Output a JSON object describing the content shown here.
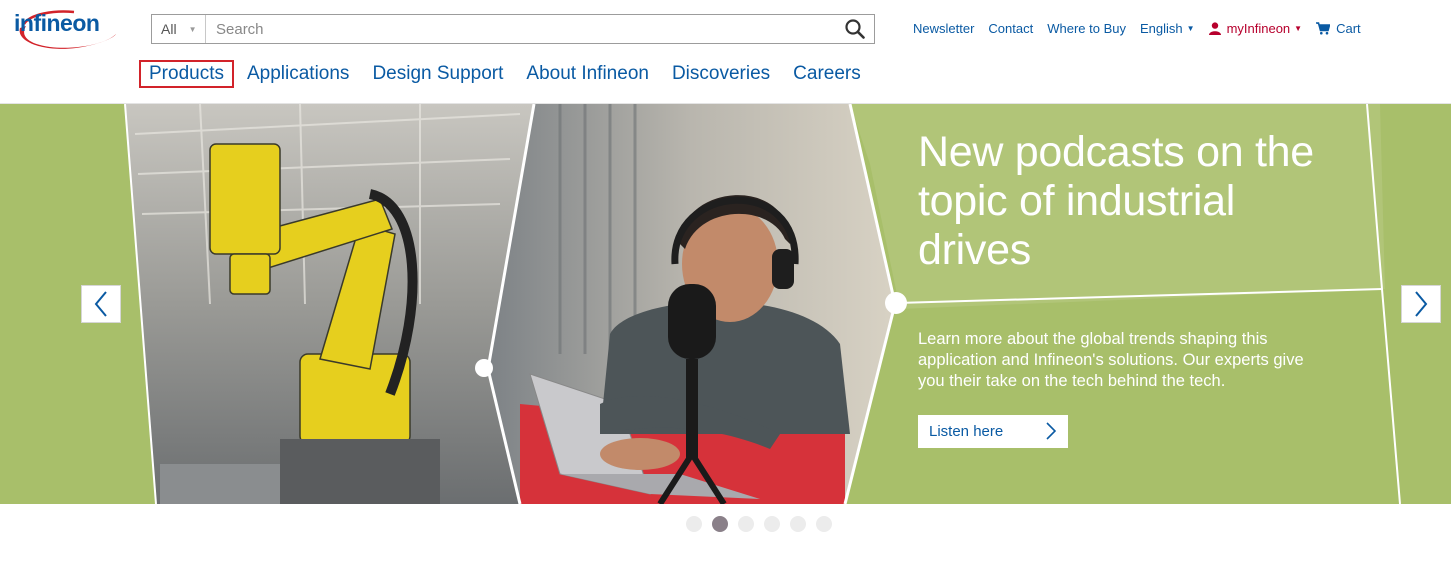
{
  "brand": {
    "logo_text": "infineon",
    "color_primary": "#0a5aa3",
    "color_logo_swoosh": "#d2232a",
    "color_accent": "#b7002d"
  },
  "search": {
    "scope": "All",
    "placeholder": "Search",
    "icon": "search-icon"
  },
  "topnav": {
    "newsletter": "Newsletter",
    "contact": "Contact",
    "where_to_buy": "Where to Buy",
    "language": "English",
    "my_infineon": "myInfineon",
    "cart": "Cart"
  },
  "mainnav": {
    "items": [
      "Products",
      "Applications",
      "Design Support",
      "About Infineon",
      "Discoveries",
      "Careers"
    ],
    "active_index": 0
  },
  "hero": {
    "title": "New podcasts on the topic of industrial drives",
    "text": "Learn more about the global trends shaping this application and Infineon's solutions. Our experts give you their take on the tech behind the tech.",
    "button_label": "Listen here",
    "background_color": "#a8bf6a",
    "prev_icon": "chevron-left-icon",
    "next_icon": "chevron-right-icon"
  },
  "carousel": {
    "slide_count": 6,
    "active_index": 1
  }
}
